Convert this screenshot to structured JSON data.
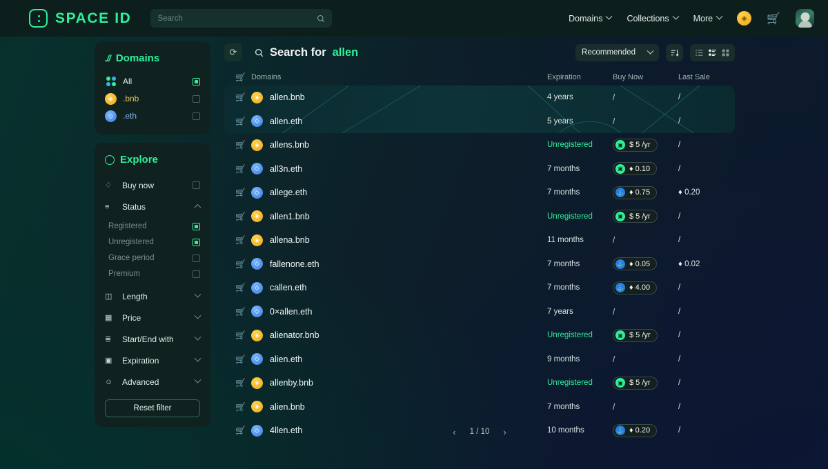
{
  "topbar": {
    "brand": "SPACE ID",
    "brand_icon": "space-id-logo",
    "search": {
      "value": "",
      "placeholder": "Search",
      "icon": "search-icon"
    },
    "nav": [
      {
        "label": "Domains",
        "icon": "chevron-down-icon"
      },
      {
        "label": "Collections",
        "icon": "chevron-down-icon"
      },
      {
        "label": "More",
        "icon": "chevron-down-icon"
      }
    ],
    "token_icon": "bnb-coin-icon",
    "cart_icon": "cart-icon",
    "avatar_icon": "user-avatar"
  },
  "sidebar": {
    "domains_panel": {
      "title": "Domains",
      "title_icon": "slash-domains-icon",
      "items": [
        {
          "label": "All",
          "icon": "four-dots-icon",
          "checked": true
        },
        {
          "label": ".bnb",
          "icon": "bnb-chain-icon",
          "checked": false
        },
        {
          "label": ".eth",
          "icon": "eth-chain-icon",
          "checked": false
        }
      ]
    },
    "explore_panel": {
      "title": "Explore",
      "title_icon": "compass-icon",
      "buy_now": {
        "label": "Buy now",
        "icon": "tag-icon",
        "checked": false
      },
      "status": {
        "label": "Status",
        "icon": "status-filter-icon",
        "expanded": true,
        "options": [
          {
            "label": "Registered",
            "checked": true
          },
          {
            "label": "Unregistered",
            "checked": true
          },
          {
            "label": "Grace period",
            "checked": false
          },
          {
            "label": "Premium",
            "checked": false
          }
        ]
      },
      "filters": [
        {
          "label": "Length",
          "icon": "length-icon"
        },
        {
          "label": "Price",
          "icon": "price-icon"
        },
        {
          "label": "Start/End with",
          "icon": "start-end-icon"
        },
        {
          "label": "Expiration",
          "icon": "calendar-icon"
        },
        {
          "label": "Advanced",
          "icon": "advanced-icon"
        }
      ],
      "reset_label": "Reset filter"
    }
  },
  "main": {
    "refresh_icon": "refresh-icon",
    "search_icon": "search-icon",
    "title_prefix": "Search for",
    "title_query": "allen",
    "sort": {
      "value": "Recommended",
      "icon": "chevron-down-icon"
    },
    "sort_order_icon": "sort-descending-icon",
    "views": [
      "list-view-icon",
      "detail-view-icon",
      "grid-view-icon"
    ],
    "active_view": "detail-view-icon",
    "columns": {
      "domains": "Domains",
      "domains_icon": "cart-icon",
      "expiration": "Expiration",
      "buy_now": "Buy Now",
      "last_sale": "Last Sale"
    },
    "rows": [
      {
        "name": "allen.bnb",
        "chain": "bnb",
        "expiration": "4 years",
        "unregistered": false,
        "buy_now": null,
        "last_sale": "/",
        "highlighted": true
      },
      {
        "name": "allen.eth",
        "chain": "eth",
        "expiration": "5 years",
        "unregistered": false,
        "buy_now": null,
        "last_sale": "/",
        "highlighted": true
      },
      {
        "name": "allens.bnb",
        "chain": "bnb",
        "expiration": "Unregistered",
        "unregistered": true,
        "buy_now": {
          "icon": "sid",
          "text": "$ 5 /yr"
        },
        "last_sale": "/",
        "highlighted": false
      },
      {
        "name": "all3n.eth",
        "chain": "eth",
        "expiration": "7 months",
        "unregistered": false,
        "buy_now": {
          "icon": "sid",
          "text": "♦ 0.10"
        },
        "last_sale": "/",
        "highlighted": false
      },
      {
        "name": "allege.eth",
        "chain": "eth",
        "expiration": "7 months",
        "unregistered": false,
        "buy_now": {
          "icon": "os",
          "text": "♦ 0.75"
        },
        "last_sale": "♦ 0.20",
        "highlighted": false
      },
      {
        "name": "allen1.bnb",
        "chain": "bnb",
        "expiration": "Unregistered",
        "unregistered": true,
        "buy_now": {
          "icon": "sid",
          "text": "$ 5 /yr"
        },
        "last_sale": "/",
        "highlighted": false
      },
      {
        "name": "allena.bnb",
        "chain": "bnb",
        "expiration": "11 months",
        "unregistered": false,
        "buy_now": null,
        "last_sale": "/",
        "highlighted": false
      },
      {
        "name": "fallenone.eth",
        "chain": "eth",
        "expiration": "7 months",
        "unregistered": false,
        "buy_now": {
          "icon": "os",
          "text": "♦ 0.05"
        },
        "last_sale": "♦ 0.02",
        "highlighted": false
      },
      {
        "name": "callen.eth",
        "chain": "eth",
        "expiration": "7 months",
        "unregistered": false,
        "buy_now": {
          "icon": "os",
          "text": "♦ 4.00"
        },
        "last_sale": "/",
        "highlighted": false
      },
      {
        "name": "0×allen.eth",
        "chain": "eth",
        "expiration": "7 years",
        "unregistered": false,
        "buy_now": null,
        "last_sale": "/",
        "highlighted": false
      },
      {
        "name": "alienator.bnb",
        "chain": "bnb",
        "expiration": "Unregistered",
        "unregistered": true,
        "buy_now": {
          "icon": "sid",
          "text": "$ 5 /yr"
        },
        "last_sale": "/",
        "highlighted": false
      },
      {
        "name": "alien.eth",
        "chain": "eth",
        "expiration": "9 months",
        "unregistered": false,
        "buy_now": null,
        "last_sale": "/",
        "highlighted": false
      },
      {
        "name": "allenby.bnb",
        "chain": "bnb",
        "expiration": "Unregistered",
        "unregistered": true,
        "buy_now": {
          "icon": "sid",
          "text": "$ 5 /yr"
        },
        "last_sale": "/",
        "highlighted": false
      },
      {
        "name": "alien.bnb",
        "chain": "bnb",
        "expiration": "7 months",
        "unregistered": false,
        "buy_now": null,
        "last_sale": "/",
        "highlighted": false
      },
      {
        "name": "4llen.eth",
        "chain": "eth",
        "expiration": "10 months",
        "unregistered": false,
        "buy_now": {
          "icon": "os",
          "text": "♦ 0.20"
        },
        "last_sale": "/",
        "highlighted": false
      }
    ],
    "pagination": {
      "prev_icon": "chevron-left-icon",
      "label": "1 / 10",
      "next_icon": "chevron-right-icon"
    }
  },
  "colors": {
    "accent": "#2ff09a",
    "bnb": "#efa817",
    "eth": "#3b7ce0",
    "opensea": "#2081e2",
    "panel": "#0f2220"
  }
}
